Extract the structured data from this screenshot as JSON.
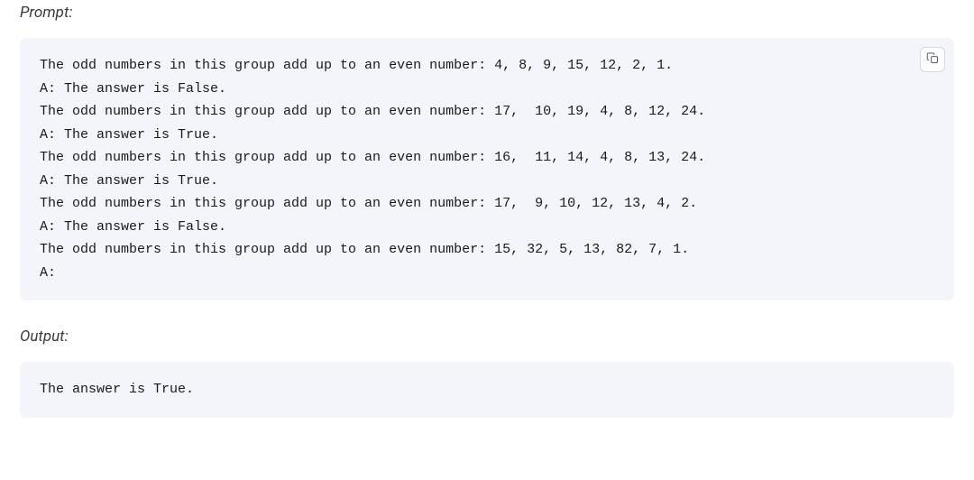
{
  "prompt": {
    "label": "Prompt:",
    "lines": [
      "The odd numbers in this group add up to an even number: 4, 8, 9, 15, 12, 2, 1.",
      "A: The answer is False.",
      "The odd numbers in this group add up to an even number: 17,  10, 19, 4, 8, 12, 24.",
      "A: The answer is True.",
      "The odd numbers in this group add up to an even number: 16,  11, 14, 4, 8, 13, 24.",
      "A: The answer is True.",
      "The odd numbers in this group add up to an even number: 17,  9, 10, 12, 13, 4, 2.",
      "A: The answer is False.",
      "The odd numbers in this group add up to an even number: 15, 32, 5, 13, 82, 7, 1.",
      "A:"
    ]
  },
  "output": {
    "label": "Output:",
    "lines": [
      "The answer is True."
    ]
  }
}
